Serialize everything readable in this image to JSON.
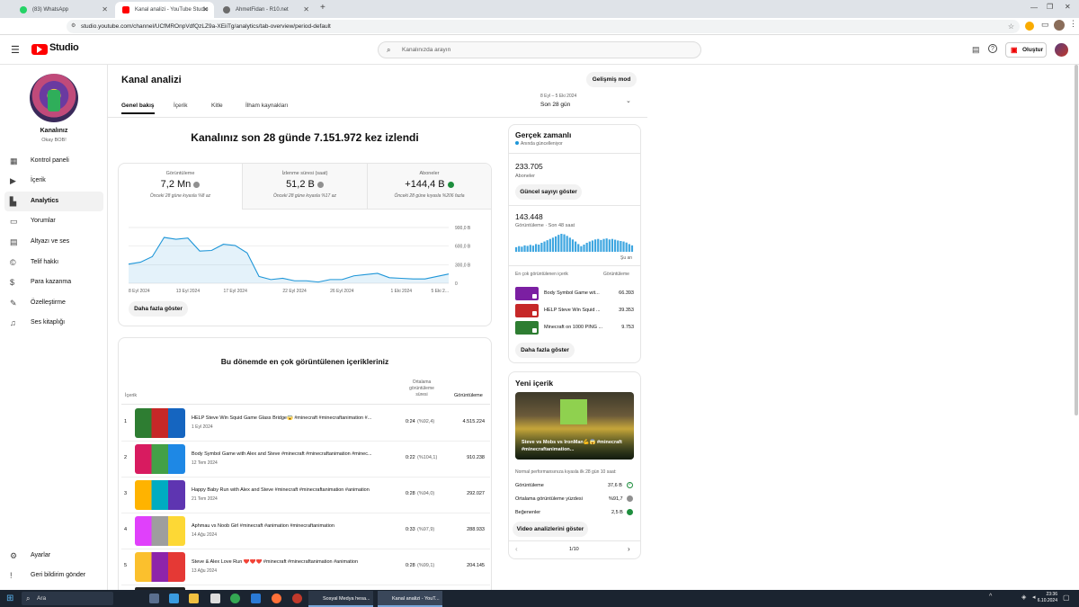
{
  "browser": {
    "tabs": [
      {
        "label": "(83) WhatsApp",
        "color": "#25d366"
      },
      {
        "label": "Kanal analizi - YouTube Studio",
        "color": "#ff0000",
        "active": true
      },
      {
        "label": "AhmetFidan - R10.net",
        "color": "#6b6b6b"
      }
    ],
    "url": "studio.youtube.com/channel/UCfMROnpVdfQzLZ9a-XEiiTg/analytics/tab-overview/period-default"
  },
  "header": {
    "logo": "Studio",
    "search_placeholder": "Kanalınızda arayın",
    "create_label": "Oluştur"
  },
  "sidebar": {
    "channel_title": "Kanalınız",
    "channel_name": "Okay BOB!",
    "items": [
      {
        "label": "Kontrol paneli",
        "icon": "dashboard-icon"
      },
      {
        "label": "İçerik",
        "icon": "content-icon"
      },
      {
        "label": "Analytics",
        "icon": "analytics-icon",
        "active": true
      },
      {
        "label": "Yorumlar",
        "icon": "comments-icon"
      },
      {
        "label": "Altyazı ve ses",
        "icon": "subtitles-icon"
      },
      {
        "label": "Telif hakkı",
        "icon": "copyright-icon"
      },
      {
        "label": "Para kazanma",
        "icon": "monetization-icon"
      },
      {
        "label": "Özelleştirme",
        "icon": "customization-icon"
      },
      {
        "label": "Ses kitaplığı",
        "icon": "audio-library-icon"
      }
    ],
    "bottom": [
      {
        "label": "Ayarlar",
        "icon": "settings-icon"
      },
      {
        "label": "Geri bildirim gönder",
        "icon": "feedback-icon"
      }
    ]
  },
  "main": {
    "page_title": "Kanal analizi",
    "advanced_mode": "Gelişmiş mod",
    "tabs": [
      "Genel bakış",
      "İçerik",
      "Kitle",
      "İlham kaynakları"
    ],
    "date_range": "8 Eyl – 5 Eki 2024",
    "period": "Son 28 gün",
    "headline": "Kanalınız son 28 günde 7.151.972 kez izlendi",
    "metrics": [
      {
        "label": "Görüntüleme",
        "value": "7,2 Mn",
        "compare": "Önceki 28 güne kıyasla %8 az"
      },
      {
        "label": "İzlenme süresi (saat)",
        "value": "51,2 B",
        "compare": "Önceki 28 güne kıyasla %17 az"
      },
      {
        "label": "Aboneler",
        "value": "+144,4 B",
        "compare": "Önceki 28 güne kıyasla %206 fazla"
      }
    ],
    "more_button": "Daha fazla göster",
    "top_content_title": "Bu dönemde en çok görüntülenen içerikleriniz",
    "table_headers": {
      "content": "İçerik",
      "avg": "Ortalama görüntüleme süresi",
      "views": "Görüntüleme"
    },
    "rows": [
      {
        "rank": "1",
        "title": "HELP Steve Win Squid Game Glass Bridge😱 #minecraft #minecraftanimation #...",
        "date": "1 Eyl 2024",
        "avg": "0:24",
        "pct": "(%92,4)",
        "views": "4.515.224"
      },
      {
        "rank": "2",
        "title": "Body Symbol Game with Alex and Steve #minecraft #minecraftanimation #minec...",
        "date": "12 Tem 2024",
        "avg": "0:22",
        "pct": "(%104,1)",
        "views": "910.238"
      },
      {
        "rank": "3",
        "title": "Happy Baby Run with Alex and Steve #minecraft #minecraftanimation #animation",
        "date": "21 Tem 2024",
        "avg": "0:28",
        "pct": "(%94,0)",
        "views": "292.027"
      },
      {
        "rank": "4",
        "title": "Aphmau vs Noob Girl #minecraft #animation #minecraftanimation",
        "date": "14 Ağu 2024",
        "avg": "0:33",
        "pct": "(%97,9)",
        "views": "288.933"
      },
      {
        "rank": "5",
        "title": "Steve & Alex Love Run ❤️❤️❤️ #minecraft #minecraftanimation #animation",
        "date": "13 Ağu 2024",
        "avg": "0:28",
        "pct": "(%99,1)",
        "views": "204.145"
      }
    ]
  },
  "realtime": {
    "title": "Gerçek zamanlı",
    "subtitle": "Anında güncelleniyor",
    "subs_value": "233.705",
    "subs_label": "Aboneler",
    "live_button": "Güncel sayıyı göster",
    "views_value": "143.448",
    "views_label": "Görüntüleme · Son 48 saat",
    "now_label": "Şu an",
    "list_header": "En çok görüntülenen içerik",
    "list_header_right": "Görüntüleme",
    "items": [
      {
        "title": "Body Symbol Game wit...",
        "views": "66.393"
      },
      {
        "title": "HELP Steve Win Squid ...",
        "views": "39.353"
      },
      {
        "title": "Minecraft on 1000 PING ...",
        "views": "9.753"
      }
    ],
    "more_button": "Daha fazla göster",
    "bars": [
      18,
      22,
      20,
      25,
      23,
      27,
      24,
      30,
      28,
      35,
      40,
      45,
      50,
      55,
      60,
      66,
      70,
      68,
      62,
      55,
      48,
      40,
      30,
      22,
      28,
      35,
      40,
      44,
      48,
      50,
      46,
      50,
      52,
      48,
      50,
      47,
      44,
      42,
      40,
      36,
      30,
      25
    ]
  },
  "new_content": {
    "title": "Yeni içerik",
    "video_title": "Steve vs Mobs vs IronMan💪😱 #minecraft #minecraftanimation...",
    "note": "Normal performansınıza kıyasla ilk 28 gün 10 saat:",
    "stats": [
      {
        "label": "Görüntüleme",
        "value": "37,6 B",
        "status": "ok"
      },
      {
        "label": "Ortalama görüntüleme yüzdesi",
        "value": "%91,7",
        "status": "neutral"
      },
      {
        "label": "Beğenenler",
        "value": "2,5 B",
        "status": "up"
      }
    ],
    "button": "Video analizlerini göster",
    "pager": "1/10"
  },
  "chart_data": {
    "type": "area",
    "x": [
      "8 Eyl",
      "9 Eyl",
      "10 Eyl",
      "11 Eyl",
      "12 Eyl",
      "13 Eyl",
      "14 Eyl",
      "15 Eyl",
      "16 Eyl",
      "17 Eyl",
      "18 Eyl",
      "19 Eyl",
      "20 Eyl",
      "21 Eyl",
      "22 Eyl",
      "23 Eyl",
      "24 Eyl",
      "25 Eyl",
      "26 Eyl",
      "27 Eyl",
      "28 Eyl",
      "29 Eyl",
      "30 Eyl",
      "1 Eki",
      "2 Eki",
      "3 Eki",
      "4 Eki",
      "5 Eki"
    ],
    "x_tick_labels": [
      "8 Eyl 2024",
      "13 Eyl 2024",
      "17 Eyl 2024",
      "22 Eyl 2024",
      "26 Eyl 2024",
      "1 Eki 2024",
      "5 Eki 2..."
    ],
    "series": [
      {
        "values": [
          310000,
          340000,
          430000,
          740000,
          710000,
          730000,
          520000,
          530000,
          630000,
          610000,
          490000,
          110000,
          60000,
          80000,
          40000,
          40000,
          20000,
          60000,
          60000,
          120000,
          140000,
          160000,
          90000,
          80000,
          70000,
          70000,
          110000,
          150000
        ]
      }
    ],
    "y_tick_labels": [
      "900,0 B",
      "600,0 B",
      "300,0 B",
      "0"
    ],
    "ylim": [
      0,
      900000
    ],
    "color": "#1e96d8"
  }
}
